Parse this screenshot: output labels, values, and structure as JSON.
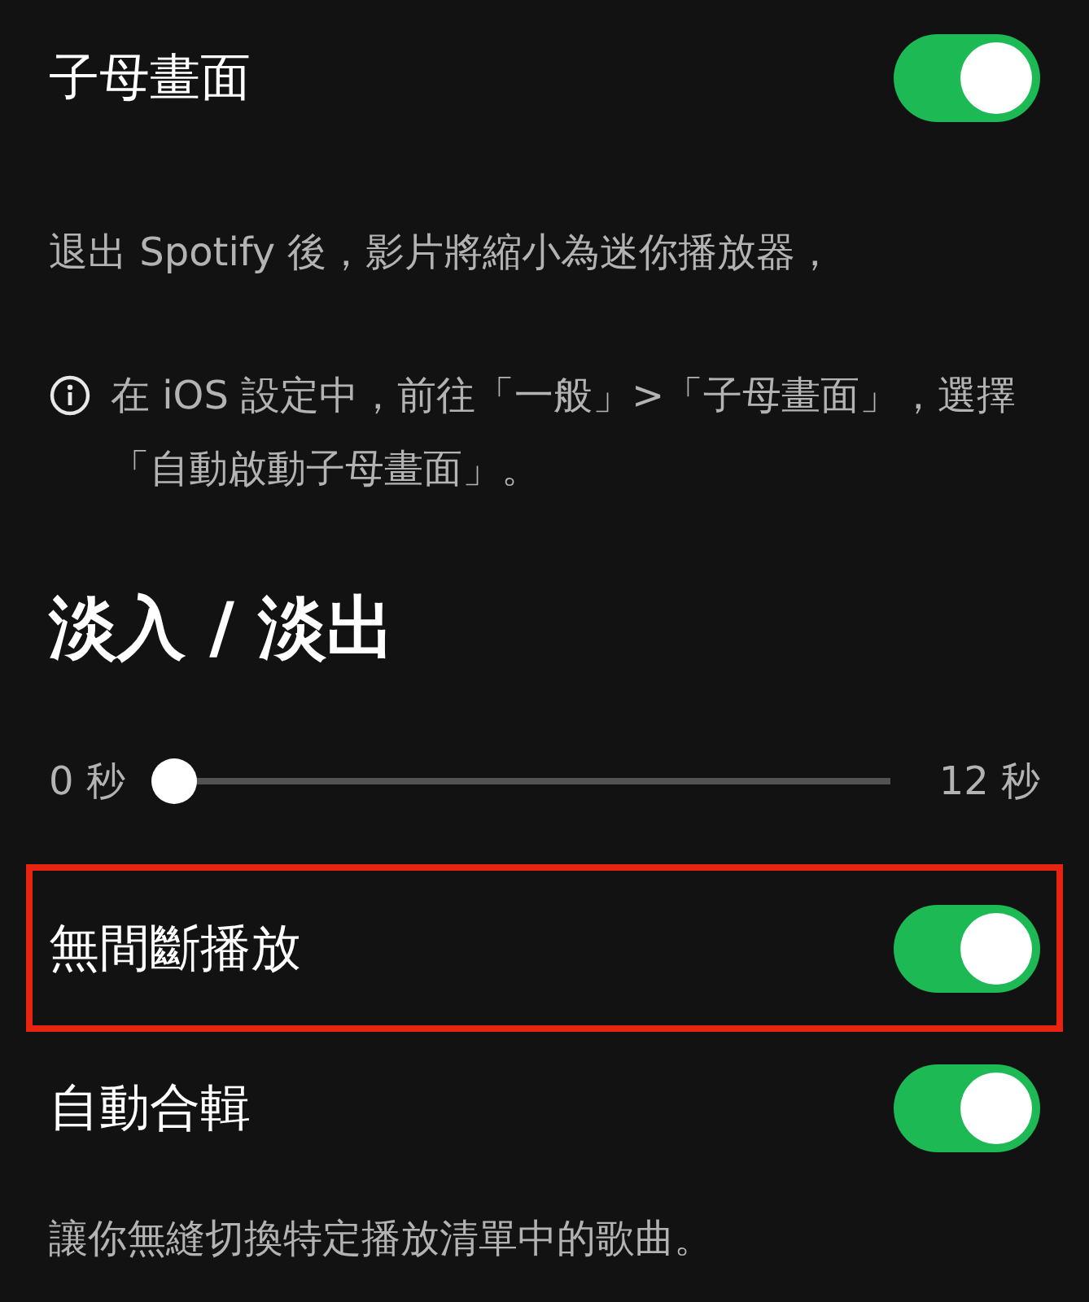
{
  "items": [
    {
      "kind": "toggle",
      "label": "子母畫面",
      "on": true,
      "highlighted": false
    },
    {
      "kind": "description",
      "text": "退出 Spotify 後，影片將縮小為迷你播放器，"
    },
    {
      "kind": "info",
      "text": "在 iOS 設定中，前往「一般」>「子母畫面」，選擇「自動啟動子母畫面」。"
    },
    {
      "kind": "heading",
      "text": "淡入 / 淡出"
    },
    {
      "kind": "slider",
      "min_label": "0 秒",
      "max_label": "12 秒",
      "level": 0
    },
    {
      "kind": "toggle",
      "label": "無間斷播放",
      "on": true,
      "highlighted": true
    },
    {
      "kind": "toggle",
      "label": "自動合輯",
      "on": true,
      "highlighted": false
    },
    {
      "kind": "description",
      "text": "讓你無縫切換特定播放清單中的歌曲。"
    }
  ]
}
